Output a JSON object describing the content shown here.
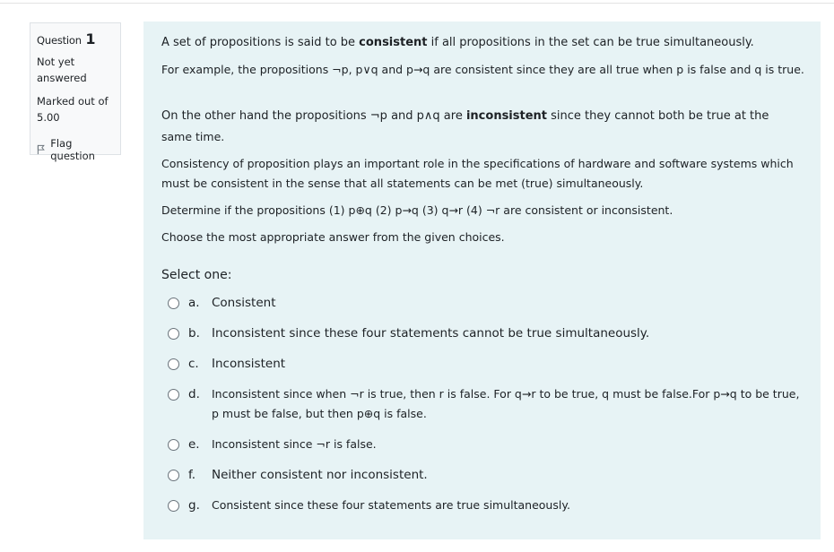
{
  "info": {
    "question_label": "Question",
    "question_number": "1",
    "state_line1": "Not yet",
    "state_line2": "answered",
    "grade_line1": "Marked out of",
    "grade_line2": "5.00",
    "flag_label": "Flag question"
  },
  "question": {
    "p1_pre": "A set of propositions is said to be ",
    "p1_bold": "consistent",
    "p1_post": " if all propositions in the set can be true  simultaneously.",
    "p2": "For example, the propositions ¬p,  p∨q  and p→q  are consistent since they are all true when p is false and q is true.",
    "p3_pre": "On the other hand the propositions ¬p  and p∧q  are ",
    "p3_bold": "inconsistent",
    "p3_post": " since they cannot  both be true at the",
    "p3_line2": "same time.",
    "p4_line1": "Consistency of proposition plays an important role in the specifications of hardware  and software systems which",
    "p4_line2": "must be consistent in the sense that all statements can  be met (true) simultaneously.",
    "p5": "Determine if the propositions (1) p⊕q  (2) p→q  (3) q→r  (4) ¬r  are consistent or inconsistent.",
    "p6": "Choose the most appropriate answer from the given choices."
  },
  "answers": {
    "prompt": "Select one:",
    "options": [
      {
        "letter": "a.",
        "text": "Consistent"
      },
      {
        "letter": "b.",
        "text": "Inconsistent since these four statements cannot be true simultaneously."
      },
      {
        "letter": "c.",
        "text": "Inconsistent"
      },
      {
        "letter": "d.",
        "text": "Inconsistent since  when  ¬r  is true, then r is false. For q→r to be true, q must be false.For p→q to be true,",
        "text2": "p must be false, but then p⊕q  is false."
      },
      {
        "letter": "e.",
        "text": "Inconsistent since   ¬r  is false."
      },
      {
        "letter": "f.",
        "text": "Neither consistent nor inconsistent."
      },
      {
        "letter": "g.",
        "text": "Consistent since these four statements are true simultaneously."
      }
    ]
  }
}
